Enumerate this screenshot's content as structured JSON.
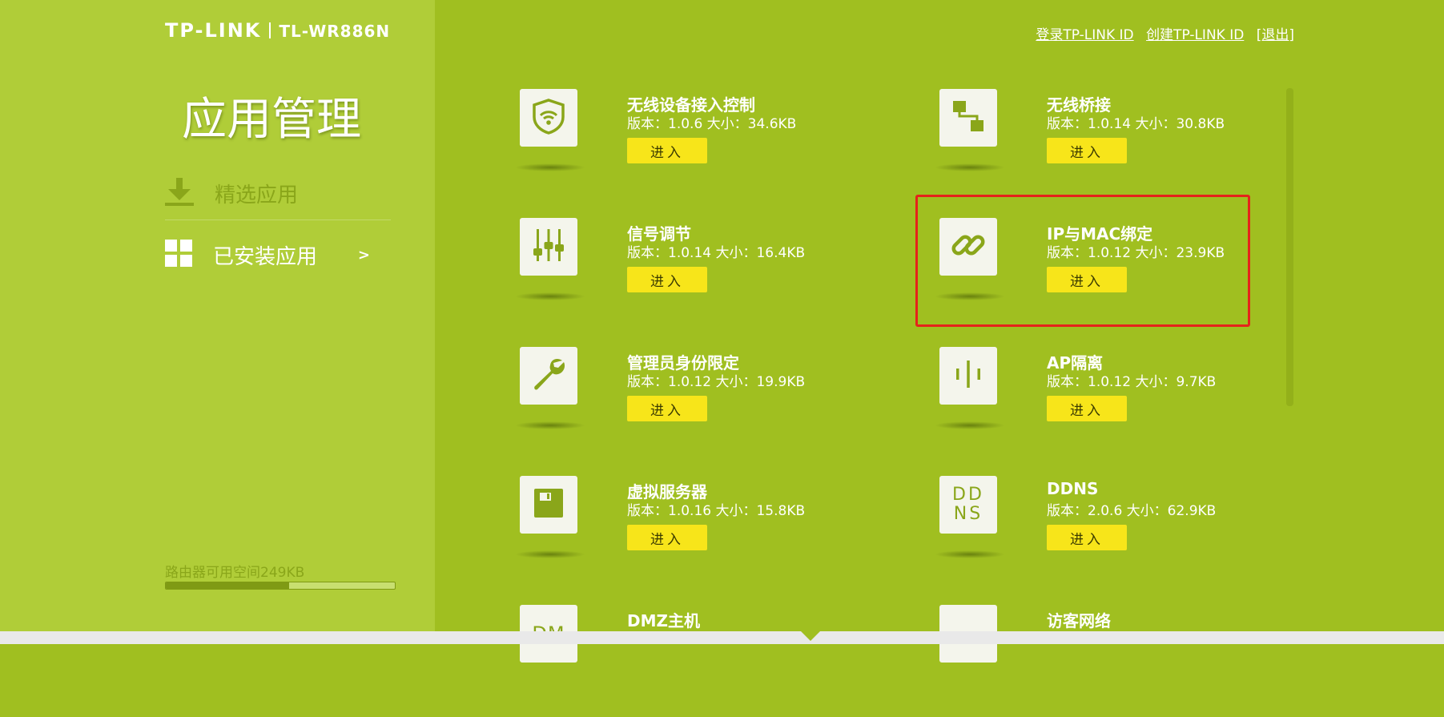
{
  "brand": {
    "logo": "TP-LINK",
    "model": "TL-WR886N"
  },
  "page_title": "应用管理",
  "sidebar": {
    "items": [
      {
        "label": "精选应用",
        "icon": "download-icon"
      },
      {
        "label": "已安装应用",
        "icon": "grid-icon",
        "arrow": ">"
      }
    ],
    "storage": {
      "label": "路由器可用空间249KB",
      "fill_fraction": 0.54
    }
  },
  "top_links": {
    "login": "登录TP-LINK ID",
    "create": "创建TP-LINK ID",
    "logout": "[退出]"
  },
  "apps": [
    {
      "name": "无线设备接入控制",
      "meta": "版本：1.0.6  大小：34.6KB",
      "button": "进入",
      "icon": "wifi-shield-icon"
    },
    {
      "name": "无线桥接",
      "meta": "版本：1.0.14  大小：30.8KB",
      "button": "进入",
      "icon": "bridge-icon"
    },
    {
      "name": "信号调节",
      "meta": "版本：1.0.14  大小：16.4KB",
      "button": "进入",
      "icon": "sliders-icon"
    },
    {
      "name": "IP与MAC绑定",
      "meta": "版本：1.0.12  大小：23.9KB",
      "button": "进入",
      "icon": "link-icon"
    },
    {
      "name": "管理员身份限定",
      "meta": "版本：1.0.12  大小：19.9KB",
      "button": "进入",
      "icon": "wrench-icon"
    },
    {
      "name": "AP隔离",
      "meta": "版本：1.0.12  大小：9.7KB",
      "button": "进入",
      "icon": "ap-isolation-icon"
    },
    {
      "name": "虚拟服务器",
      "meta": "版本：1.0.16  大小：15.8KB",
      "button": "进入",
      "icon": "server-icon"
    },
    {
      "name": "DDNS",
      "meta": "版本：2.0.6  大小：62.9KB",
      "button": "进入",
      "icon": "ddns-icon",
      "icon_text": [
        "DD",
        "NS"
      ]
    },
    {
      "name": "DMZ主机",
      "meta": "",
      "button": "",
      "icon": "dmz-icon",
      "icon_text": "DM"
    },
    {
      "name": "访客网络",
      "meta": "",
      "button": "",
      "icon": "guest-icon"
    }
  ],
  "colors": {
    "sidebar_bg": "#b0cd38",
    "main_bg": "#a0bf20",
    "button_bg": "#f7e51a",
    "highlight": "#e5231a"
  }
}
